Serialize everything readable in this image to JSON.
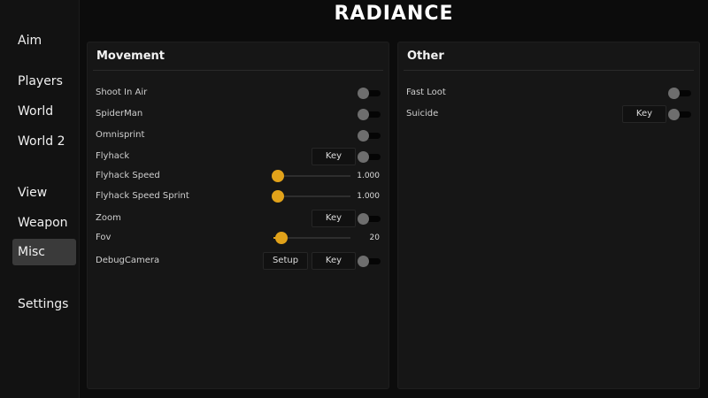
{
  "app": {
    "title": "RADIANCE"
  },
  "sidebar": {
    "items": [
      {
        "label": "Aim"
      },
      {
        "label": "Players"
      },
      {
        "label": "World"
      },
      {
        "label": "World 2"
      },
      {
        "label": "View"
      },
      {
        "label": "Weapon"
      },
      {
        "label": "Misc",
        "active": true
      },
      {
        "label": "Settings"
      }
    ]
  },
  "colors": {
    "accent": "#e1a21a",
    "toggle_off": "#6e6e6e"
  },
  "movement": {
    "title": "Movement",
    "shoot_in_air": {
      "label": "Shoot In Air",
      "enabled": false
    },
    "spiderman": {
      "label": "SpiderMan",
      "enabled": false
    },
    "omnisprint": {
      "label": "Omnisprint",
      "enabled": false
    },
    "flyhack": {
      "label": "Flyhack",
      "key_label": "Key",
      "enabled": false
    },
    "flyhack_speed": {
      "label": "Flyhack Speed",
      "value": "1.000",
      "fraction": 0.0
    },
    "flyhack_speed_sprint": {
      "label": "Flyhack Speed Sprint",
      "value": "1.000",
      "fraction": 0.0
    },
    "zoom": {
      "label": "Zoom",
      "key_label": "Key",
      "enabled": false
    },
    "fov": {
      "label": "Fov",
      "value": "20",
      "fraction": 0.1
    },
    "debug_camera": {
      "label": "DebugCamera",
      "setup_label": "Setup",
      "key_label": "Key",
      "enabled": false
    }
  },
  "other": {
    "title": "Other",
    "fast_loot": {
      "label": "Fast Loot",
      "enabled": false
    },
    "suicide": {
      "label": "Suicide",
      "key_label": "Key",
      "enabled": false
    }
  }
}
